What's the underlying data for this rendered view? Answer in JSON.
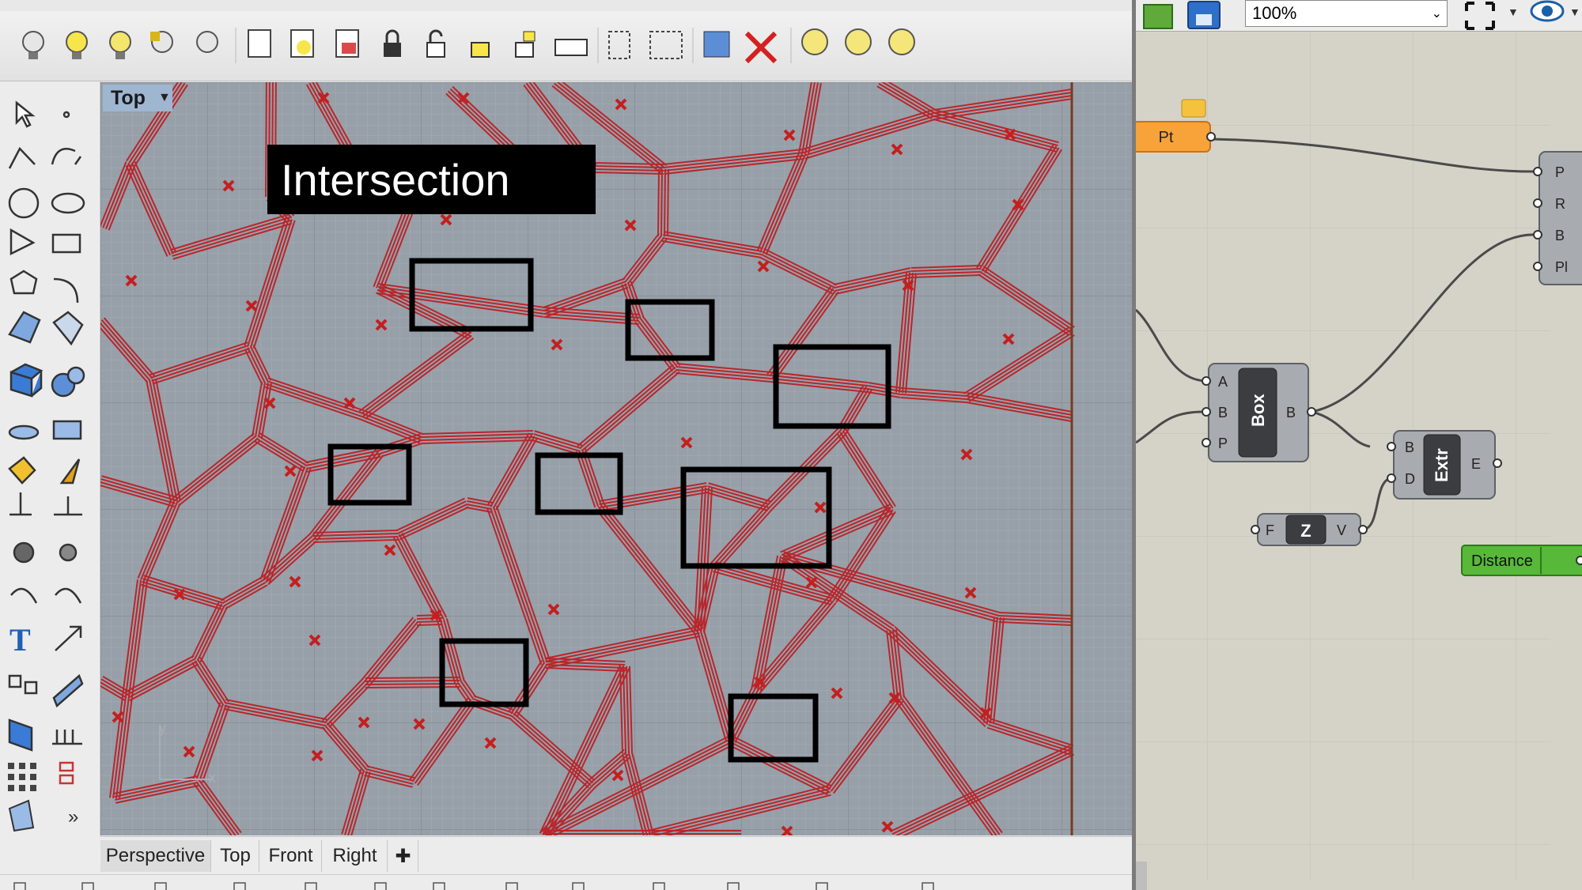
{
  "viewport": {
    "label": "Top",
    "title": "Intersection"
  },
  "view_tabs": [
    "Perspective",
    "Top",
    "Front",
    "Right"
  ],
  "grasshopper": {
    "zoom": "100%",
    "nodes": {
      "point_param": "Pt",
      "right_component_inputs": [
        "P",
        "R",
        "B",
        "Pl"
      ],
      "box": {
        "name": "Box",
        "inputs": [
          "A",
          "B",
          "P"
        ],
        "output": "B"
      },
      "extrude": {
        "name": "Extr",
        "inputs": [
          "B",
          "D"
        ],
        "output": "E"
      },
      "unit_z": {
        "name": "Z",
        "input": "F",
        "output": "V"
      },
      "distance": "Distance"
    }
  },
  "icons": [
    "light-bulb-icon",
    "lock-icon",
    "select-arrow-icon",
    "point-icon",
    "curve-icon",
    "circle-icon",
    "arc-icon",
    "rectangle-icon",
    "polygon-icon",
    "fillet-icon",
    "surface-icon",
    "box-solid-icon",
    "sphere-icon",
    "cylinder-icon",
    "mesh-icon",
    "text-icon",
    "array-icon",
    "rotate-icon",
    "move-icon",
    "more-icon",
    "eye-icon",
    "save-icon",
    "open-icon"
  ],
  "colors": {
    "grid_bg": "#97a0a9",
    "voronoi_red": "#b8262b",
    "point_red": "#c41f1f",
    "param_orange": "#f7a33a",
    "component_grey": "#a6a9ad",
    "distance_green": "#58b83a",
    "canvas_bg": "#d5d3c8"
  }
}
